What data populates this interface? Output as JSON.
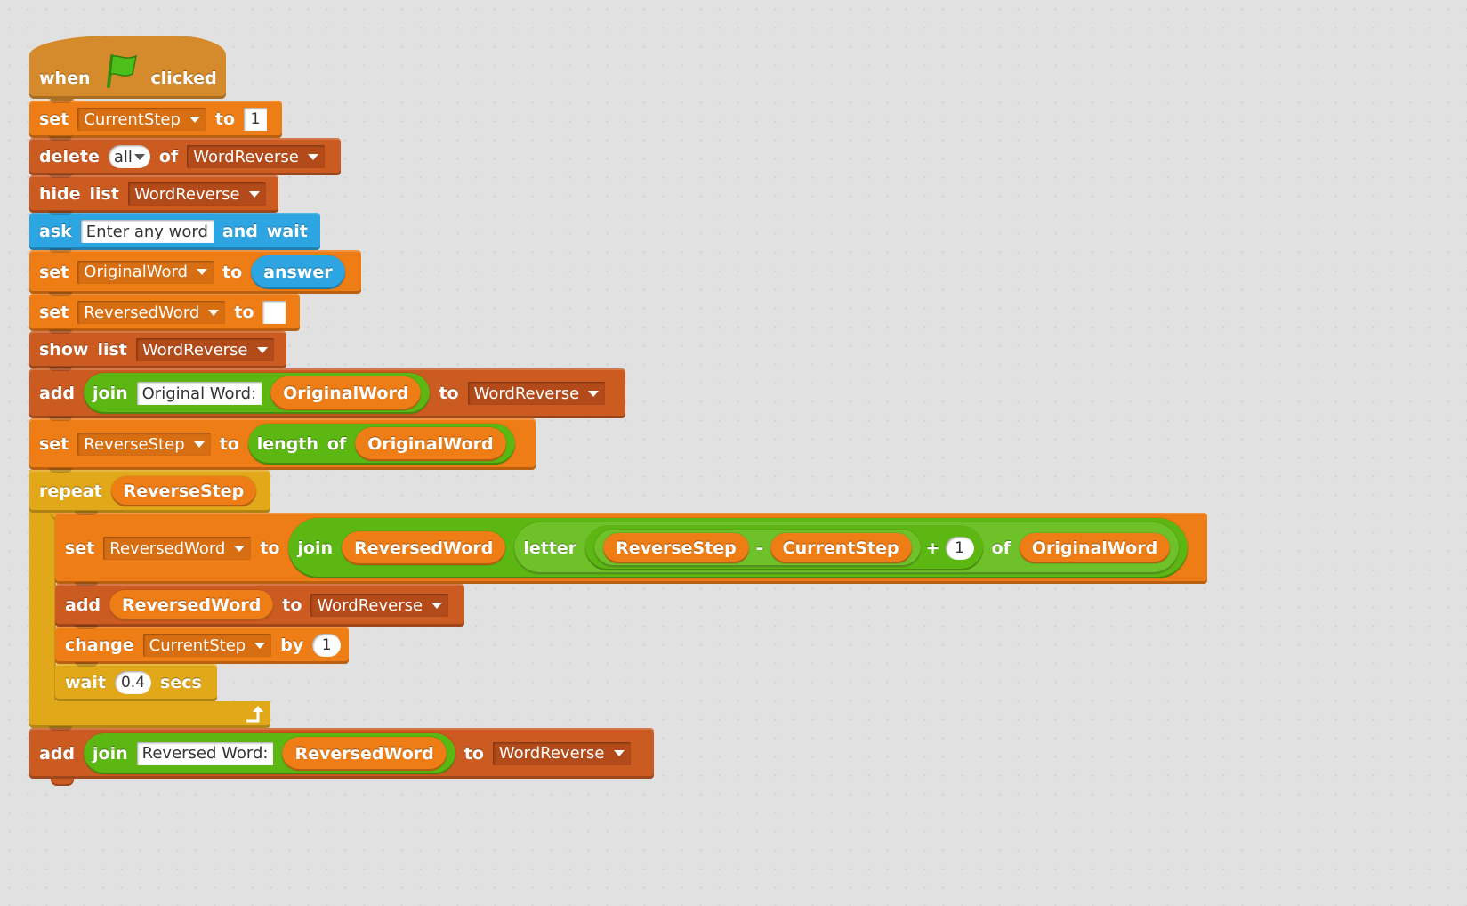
{
  "script": {
    "hat": {
      "when": "when",
      "clicked": "clicked"
    },
    "b1": {
      "keyword": "set",
      "var": "CurrentStep",
      "to": "to",
      "value": "1"
    },
    "b2": {
      "keyword": "delete",
      "item": "all",
      "of": "of",
      "list": "WordReverse"
    },
    "b3": {
      "keyword1": "hide",
      "keyword2": "list",
      "list": "WordReverse"
    },
    "b4": {
      "keyword": "ask",
      "text": "Enter any word",
      "and": "and",
      "wait": "wait"
    },
    "b5": {
      "keyword": "set",
      "var": "OriginalWord",
      "to": "to",
      "reporter": "answer"
    },
    "b6": {
      "keyword": "set",
      "var": "ReversedWord",
      "to": "to",
      "value": ""
    },
    "b7": {
      "keyword1": "show",
      "keyword2": "list",
      "list": "WordReverse"
    },
    "b8": {
      "keyword": "add",
      "join": "join",
      "text": "Original Word:",
      "reporter": "OriginalWord",
      "to": "to",
      "list": "WordReverse"
    },
    "b9": {
      "keyword": "set",
      "var": "ReverseStep",
      "to": "to",
      "length": "length",
      "of": "of",
      "reporter": "OriginalWord"
    },
    "repeat": {
      "keyword": "repeat",
      "reporter": "ReverseStep"
    },
    "r1": {
      "keyword": "set",
      "var": "ReversedWord",
      "to": "to",
      "join": "join",
      "reporter1": "ReversedWord",
      "letter": "letter",
      "reporter2": "ReverseStep",
      "minus": "-",
      "reporter3": "CurrentStep",
      "plus": "+",
      "num": "1",
      "of": "of",
      "reporter4": "OriginalWord"
    },
    "r2": {
      "keyword": "add",
      "reporter": "ReversedWord",
      "to": "to",
      "list": "WordReverse"
    },
    "r3": {
      "keyword": "change",
      "var": "CurrentStep",
      "by": "by",
      "value": "1"
    },
    "r4": {
      "keyword": "wait",
      "value": "0.4",
      "secs": "secs"
    },
    "b10": {
      "keyword": "add",
      "join": "join",
      "text": "Reversed Word:",
      "reporter": "ReversedWord",
      "to": "to",
      "list": "WordReverse"
    }
  },
  "icons": {
    "flag": "green-flag-icon",
    "dropdown": "dropdown-arrow-icon",
    "loop": "loop-arrow-icon"
  },
  "colors": {
    "events": "#d58a2c",
    "data": "#ee7d16",
    "list": "#cc5b22",
    "sensing": "#2ca5e2",
    "control": "#e1a91a",
    "operators": "#5cb712",
    "canvas": "#e1e1e1"
  }
}
